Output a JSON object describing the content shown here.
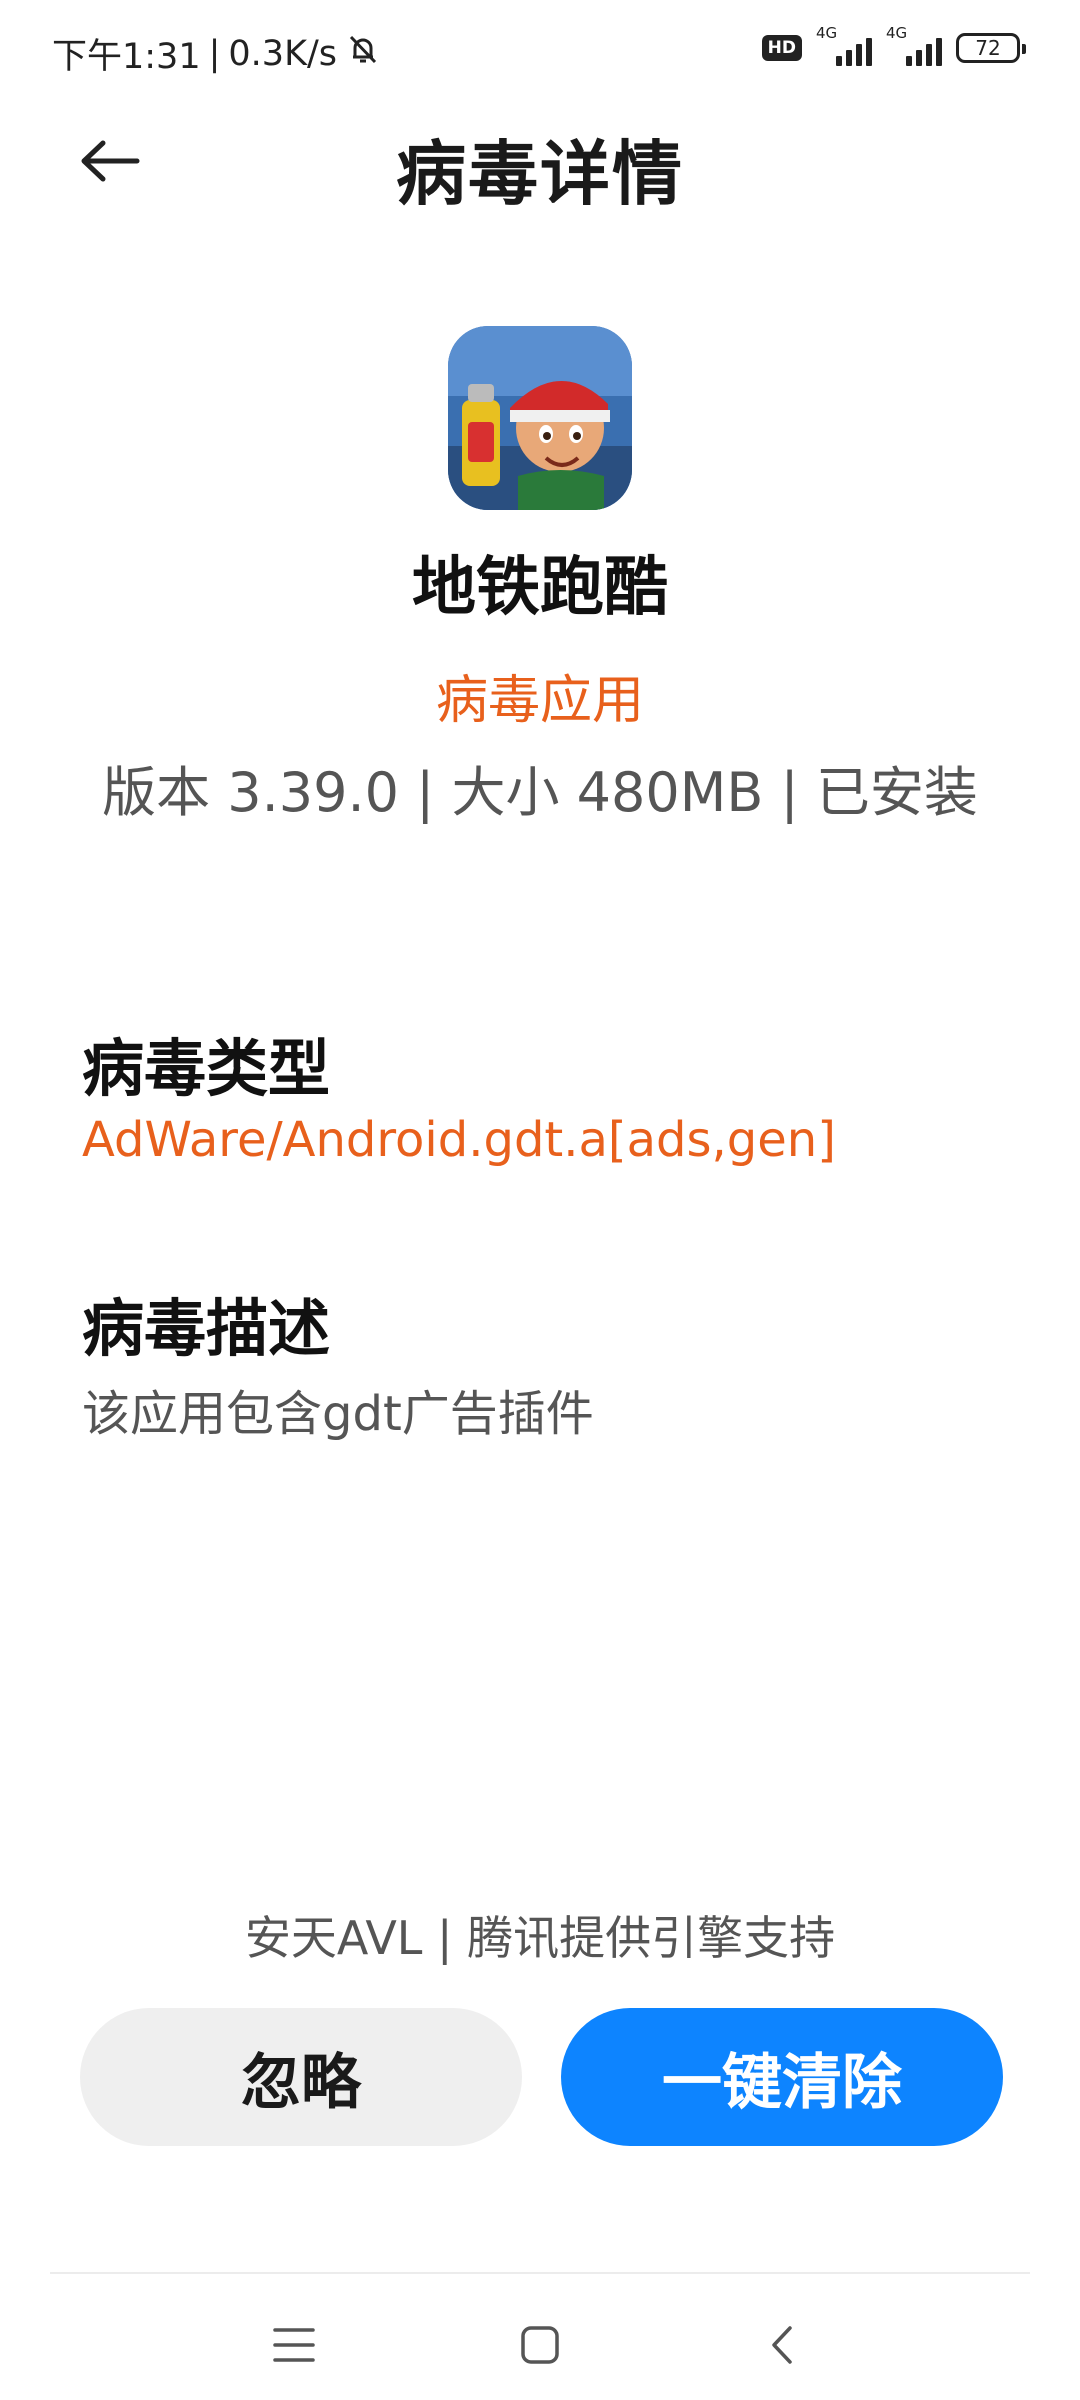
{
  "status_bar": {
    "time": "下午1:31",
    "net_speed": "0.3K/s",
    "hd": "HD",
    "signal1_type": "4G",
    "signal2_type": "4G",
    "battery": "72"
  },
  "header": {
    "title": "病毒详情"
  },
  "app": {
    "name": "地铁跑酷",
    "threat_label": "病毒应用",
    "meta": "版本 3.39.0 | 大小 480MB | 已安装"
  },
  "virus_type": {
    "heading": "病毒类型",
    "value": "AdWare/Android.gdt.a[ads,gen]"
  },
  "virus_desc": {
    "heading": "病毒描述",
    "value": "该应用包含gdt广告插件"
  },
  "footer": {
    "engine_credit": "安天AVL | 腾讯提供引擎支持",
    "ignore_label": "忽略",
    "clean_label": "一键清除"
  },
  "colors": {
    "accent_orange": "#e8601c",
    "primary_blue": "#0d84ff"
  },
  "icons": {
    "back": "arrow-left-icon",
    "mute": "bell-off-icon",
    "nav_menu": "menu-icon",
    "nav_home": "home-icon",
    "nav_back": "chevron-left-icon"
  }
}
